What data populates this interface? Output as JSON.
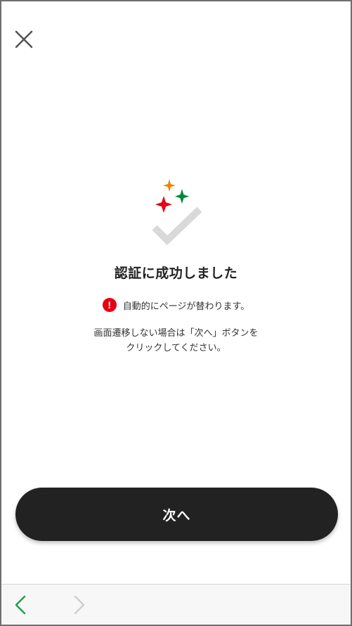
{
  "header": {
    "close_icon": "close-icon"
  },
  "illustration": {
    "icon": "checkmark-with-sparkles-icon",
    "colors": {
      "check": "#d9d9d9",
      "sparkle_orange": "#f08300",
      "sparkle_green": "#00873c",
      "sparkle_red": "#e60012"
    }
  },
  "main": {
    "title": "認証に成功しました",
    "notice": {
      "icon": "alert-icon",
      "icon_glyph": "!",
      "text": "自動的にページが替わります。"
    },
    "description": {
      "line1": "画面遷移しない場合は「次へ」ボタンを",
      "line2": "クリックしてください。"
    },
    "next_button_label": "次へ"
  },
  "browser_bar": {
    "back_icon": "chevron-left-icon",
    "forward_icon": "chevron-right-icon",
    "accent": "#1e9e4a",
    "disabled": "#cfcfcf"
  }
}
